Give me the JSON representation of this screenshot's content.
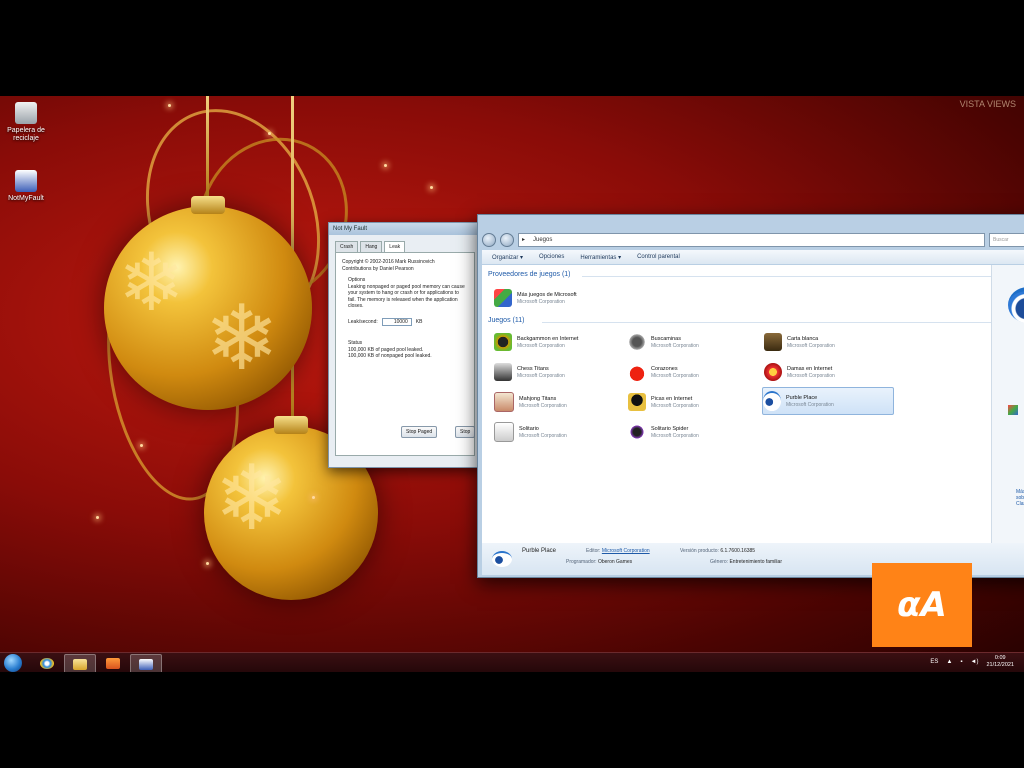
{
  "desktop": {
    "icons": [
      {
        "label": "Papelera de reciclaje"
      },
      {
        "label": "NotMyFault"
      }
    ],
    "watermark": "VISTA VIEWS"
  },
  "notmyfault": {
    "title": "Not My Fault",
    "tabs": [
      "Crash",
      "Hang",
      "Leak"
    ],
    "active_tab": "Leak",
    "copyright": "Copyright © 2002-2016 Mark Russinovich",
    "contributions": "Contributions by Daniel Pearson",
    "options_label": "Options",
    "description": "Leaking nonpaged or paged pool memory can cause your system to hang or crash or for applications to fail. The memory is released when the application closes.",
    "leak_label": "Leak/second:",
    "leak_value": "10000",
    "leak_unit": "KB",
    "status_label": "Status",
    "status_paged": "100,000 KB of paged pool leaked.",
    "status_nonpaged": "100,000 KB of nonpaged pool leaked.",
    "btn_stop_paged": "Stop Paged",
    "btn_stop_nonpaged": "Stop"
  },
  "explorer": {
    "address": "Juegos",
    "search_placeholder": "Buscar",
    "commands": [
      "Organizar ▾",
      "Opciones",
      "Herramientas ▾",
      "Control parental"
    ],
    "group_providers": "Proveedores de juegos (1)",
    "provider": {
      "name": "Más juegos de Microsoft",
      "publisher": "Microsoft Corporation"
    },
    "group_games": "Juegos (11)",
    "games": [
      {
        "name": "Backgammon en Internet",
        "publisher": "Microsoft Corporation"
      },
      {
        "name": "Buscaminas",
        "publisher": "Microsoft Corporation"
      },
      {
        "name": "Carta blanca",
        "publisher": "Microsoft Corporation"
      },
      {
        "name": "Chess Titans",
        "publisher": "Microsoft Corporation"
      },
      {
        "name": "Corazones",
        "publisher": "Microsoft Corporation"
      },
      {
        "name": "Damas en Internet",
        "publisher": "Microsoft Corporation"
      },
      {
        "name": "Mahjong Titans",
        "publisher": "Microsoft Corporation"
      },
      {
        "name": "Picas en Internet",
        "publisher": "Microsoft Corporation"
      },
      {
        "name": "Purble Place",
        "publisher": "Microsoft Corporation"
      },
      {
        "name": "Solitario",
        "publisher": "Microsoft Corporation"
      },
      {
        "name": "Solitario Spider",
        "publisher": "Microsoft Corporation"
      }
    ],
    "selected_game": "Purble Place",
    "preview_text": "Más sobre Clasificación",
    "details": {
      "name": "Purble Place",
      "editor_label": "Editor:",
      "editor_value": "Microsoft Corporation",
      "version_label": "Versión producto:",
      "version_value": "6.1.7600.16385",
      "developer_label": "Programador:",
      "developer_value": "Oberon Games",
      "genre_label": "Género:",
      "genre_value": "Entretenimiento familiar"
    }
  },
  "logo_text": "αA",
  "taskbar": {
    "lang": "ES",
    "time": "0:09",
    "date": "21/12/2021"
  }
}
